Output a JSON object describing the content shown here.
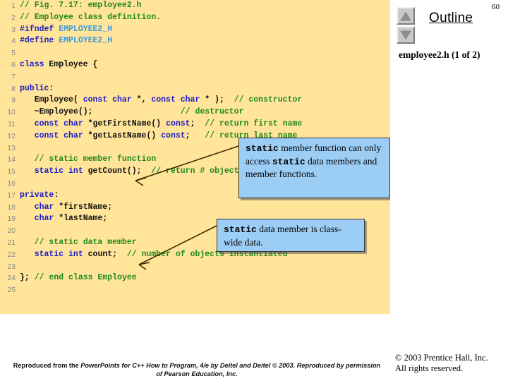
{
  "slide": {
    "page_number": "60",
    "outline_title": "Outline",
    "outline_subtitle": "employee2.h (1 of 2)",
    "background_code_panel_color": "#ffe49a",
    "callout_color": "#9ccdf5"
  },
  "nav": {
    "up_label": "▲",
    "down_label": "▼"
  },
  "code": {
    "lines": [
      {
        "n": "1",
        "segments": [
          {
            "t": "// Fig. 7.17: employee2.h",
            "c": "cm"
          }
        ]
      },
      {
        "n": "2",
        "segments": [
          {
            "t": "// Employee class definition.",
            "c": "cm"
          }
        ]
      },
      {
        "n": "3",
        "segments": [
          {
            "t": "#ifndef ",
            "c": "pp"
          },
          {
            "t": "EMPLOYEE2_H",
            "c": "mac"
          }
        ]
      },
      {
        "n": "4",
        "segments": [
          {
            "t": "#define ",
            "c": "pp"
          },
          {
            "t": "EMPLOYEE2_H",
            "c": "mac"
          }
        ]
      },
      {
        "n": "5",
        "segments": []
      },
      {
        "n": "6",
        "segments": [
          {
            "t": "class",
            "c": "kw"
          },
          {
            "t": " Employee {",
            "c": "pl"
          }
        ]
      },
      {
        "n": "7",
        "segments": []
      },
      {
        "n": "8",
        "segments": [
          {
            "t": "public",
            "c": "kw"
          },
          {
            "t": ":",
            "c": "pl"
          }
        ]
      },
      {
        "n": "9",
        "segments": [
          {
            "t": "   Employee( ",
            "c": "pl"
          },
          {
            "t": "const char",
            "c": "kw"
          },
          {
            "t": " *, ",
            "c": "pl"
          },
          {
            "t": "const char",
            "c": "kw"
          },
          {
            "t": " * );  ",
            "c": "pl"
          },
          {
            "t": "// constructor",
            "c": "cm"
          }
        ]
      },
      {
        "n": "10",
        "segments": [
          {
            "t": "   ~Employee();                  ",
            "c": "pl"
          },
          {
            "t": "// destructor",
            "c": "cm"
          }
        ]
      },
      {
        "n": "11",
        "segments": [
          {
            "t": "   ",
            "c": "pl"
          },
          {
            "t": "const char",
            "c": "kw"
          },
          {
            "t": " *getFirstName() ",
            "c": "pl"
          },
          {
            "t": "const",
            "c": "kw"
          },
          {
            "t": ";  ",
            "c": "pl"
          },
          {
            "t": "// return first name",
            "c": "cm"
          }
        ]
      },
      {
        "n": "12",
        "segments": [
          {
            "t": "   ",
            "c": "pl"
          },
          {
            "t": "const char",
            "c": "kw"
          },
          {
            "t": " *getLastName() ",
            "c": "pl"
          },
          {
            "t": "const",
            "c": "kw"
          },
          {
            "t": ";   ",
            "c": "pl"
          },
          {
            "t": "// return last name",
            "c": "cm"
          }
        ]
      },
      {
        "n": "13",
        "segments": []
      },
      {
        "n": "14",
        "segments": [
          {
            "t": "   // static member function",
            "c": "cm"
          }
        ]
      },
      {
        "n": "15",
        "segments": [
          {
            "t": "   ",
            "c": "pl"
          },
          {
            "t": "static int",
            "c": "kw"
          },
          {
            "t": " getCount();  ",
            "c": "pl"
          },
          {
            "t": "// return # objects instantiated",
            "c": "cm"
          }
        ]
      },
      {
        "n": "16",
        "segments": []
      },
      {
        "n": "17",
        "segments": [
          {
            "t": "private",
            "c": "kw"
          },
          {
            "t": ":",
            "c": "pl"
          }
        ]
      },
      {
        "n": "18",
        "segments": [
          {
            "t": "   ",
            "c": "pl"
          },
          {
            "t": "char",
            "c": "kw"
          },
          {
            "t": " *firstName;",
            "c": "pl"
          }
        ]
      },
      {
        "n": "19",
        "segments": [
          {
            "t": "   ",
            "c": "pl"
          },
          {
            "t": "char",
            "c": "kw"
          },
          {
            "t": " *lastName;",
            "c": "pl"
          }
        ]
      },
      {
        "n": "20",
        "segments": []
      },
      {
        "n": "21",
        "segments": [
          {
            "t": "   // static data member",
            "c": "cm"
          }
        ]
      },
      {
        "n": "22",
        "segments": [
          {
            "t": "   ",
            "c": "pl"
          },
          {
            "t": "static int",
            "c": "kw"
          },
          {
            "t": " count;  ",
            "c": "pl"
          },
          {
            "t": "// number of objects instantiated",
            "c": "cm"
          }
        ]
      },
      {
        "n": "23",
        "segments": []
      },
      {
        "n": "24",
        "segments": [
          {
            "t": "}; ",
            "c": "pl"
          },
          {
            "t": "// end class Employee",
            "c": "cm"
          }
        ]
      },
      {
        "n": "25",
        "segments": []
      }
    ]
  },
  "callouts": [
    {
      "name": "static-member-function",
      "parts": [
        {
          "t": "static",
          "mono": true
        },
        {
          "t": " member function can only access ",
          "mono": false
        },
        {
          "t": "static",
          "mono": true
        },
        {
          "t": " data members and member functions.",
          "mono": false
        }
      ]
    },
    {
      "name": "static-data-member",
      "parts": [
        {
          "t": "static",
          "mono": true
        },
        {
          "t": " data member is class-wide data.",
          "mono": false
        }
      ]
    }
  ],
  "footer": {
    "credit_prefix": "Reproduced from the ",
    "credit_italic_1": "PowerPoints for C++ How to Program, 4/e by Deitel and Deitel © 2003. Reproduced by permission of Pearson Education, Inc.",
    "copyright_line_1": "© 2003 Prentice Hall, Inc.",
    "copyright_line_2": "All rights reserved."
  }
}
